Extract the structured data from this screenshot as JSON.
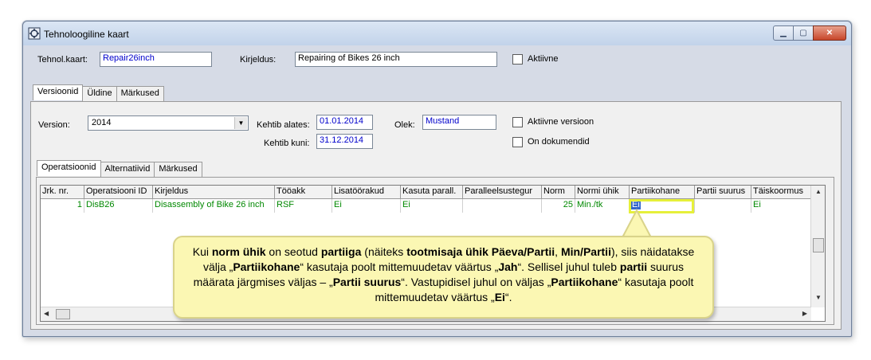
{
  "window": {
    "title": "Tehnoloogiline kaart"
  },
  "header": {
    "tehnol_label": "Tehnol.kaart:",
    "tehnol_value": "Repair26inch",
    "kirjeldus_label": "Kirjeldus:",
    "kirjeldus_value": "Repairing of Bikes 26 inch",
    "aktiivne_label": "Aktiivne"
  },
  "top_tabs": [
    "Versioonid",
    "Üldine",
    "Märkused"
  ],
  "version": {
    "version_label": "Version:",
    "version_value": "2014",
    "kehtib_alates_label": "Kehtib alates:",
    "kehtib_alates_value": "01.01.2014",
    "kehtib_kuni_label": "Kehtib kuni:",
    "kehtib_kuni_value": "31.12.2014",
    "olek_label": "Olek:",
    "olek_value": "Mustand",
    "aktiivne_versioon_label": "Aktiivne versioon",
    "on_dokumendid_label": "On dokumendid"
  },
  "inner_tabs": [
    "Operatsioonid",
    "Alternatiivid",
    "Märkused"
  ],
  "table": {
    "columns": [
      "Jrk. nr.",
      "Operatsiooni ID",
      "Kirjeldus",
      "Tööakk",
      "Lisatöörakud",
      "Kasuta parall.",
      "Paralleelsustegur",
      "Norm",
      "Normi ühik",
      "Partiikohane",
      "Partii suurus",
      "Täiskoormus"
    ],
    "rows": [
      [
        "1",
        "DisB26",
        "Disassembly of Bike 26 inch",
        "RSF",
        "Ei",
        "Ei",
        "",
        "25",
        "Min./tk",
        "Ei",
        "",
        "Ei"
      ]
    ]
  },
  "callout": {
    "p1": "Kui ",
    "b1": "norm ühik",
    "p2": " on seotud ",
    "b2": "partiiga",
    "p3": " (näiteks ",
    "b3": "tootmisaja ühik Päeva/Partii",
    "p4": ", ",
    "b4": "Min/Partii",
    "p5": "), siis näidatakse välja „",
    "b5": "Partiikohane",
    "p6": "“ kasutaja poolt mittemuudetav väärtus „",
    "b6": "Jah",
    "p7": "“. Sellisel juhul tuleb ",
    "b7": "partii",
    "p8": " suurus määrata järgmises väljas – „",
    "b8": "Partii suurus",
    "p9": "“. Vastupidisel juhul on väljas „",
    "b9": "Partiikohane",
    "p10": "“ kasutaja poolt mittemuudetav väärtus „",
    "b10": "Ei",
    "p11": "“."
  }
}
